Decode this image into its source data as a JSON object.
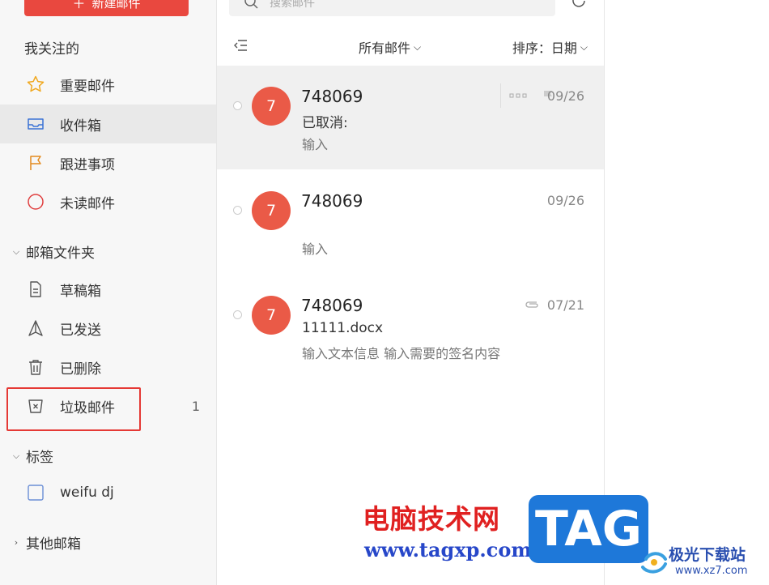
{
  "sidebar": {
    "new_button": "新建邮件",
    "followed_title": "我关注的",
    "items": [
      {
        "label": "重要邮件",
        "icon": "star-icon"
      },
      {
        "label": "收件箱",
        "icon": "inbox-icon"
      },
      {
        "label": "跟进事项",
        "icon": "flag-icon"
      },
      {
        "label": "未读邮件",
        "icon": "circle-icon"
      }
    ],
    "folders_title": "邮箱文件夹",
    "folders": [
      {
        "label": "草稿箱",
        "icon": "draft-icon"
      },
      {
        "label": "已发送",
        "icon": "sent-icon"
      },
      {
        "label": "已删除",
        "icon": "trash-icon"
      },
      {
        "label": "垃圾邮件",
        "icon": "spam-icon",
        "count": "1"
      }
    ],
    "tags_title": "标签",
    "tags": [
      {
        "label": "weifu dj",
        "icon": "tag-checkbox-icon"
      }
    ],
    "other_title": "其他邮箱"
  },
  "list": {
    "search_placeholder": "搜索邮件",
    "filter_label": "所有邮件",
    "sort_label": "排序：日期",
    "mails": [
      {
        "avatar": "7",
        "sender": "748069",
        "subject": "已取消:",
        "preview": "输入",
        "date": "09/26"
      },
      {
        "avatar": "7",
        "sender": "748069",
        "subject": "",
        "preview": "输入",
        "date": "09/26"
      },
      {
        "avatar": "7",
        "sender": "748069",
        "subject": "11111.docx",
        "preview": "输入文本信息 输入需要的签名内容",
        "date": "07/21"
      }
    ]
  },
  "watermark": {
    "cn": "电脑技术网",
    "url": "www.tagxp.com",
    "tag": "TAG",
    "logo_text": "极光下载站",
    "logo_url": "www.xz7.com"
  },
  "colors": {
    "accent": "#e9483f",
    "avatar": "#ea5a47",
    "highlight": "#e53935"
  }
}
